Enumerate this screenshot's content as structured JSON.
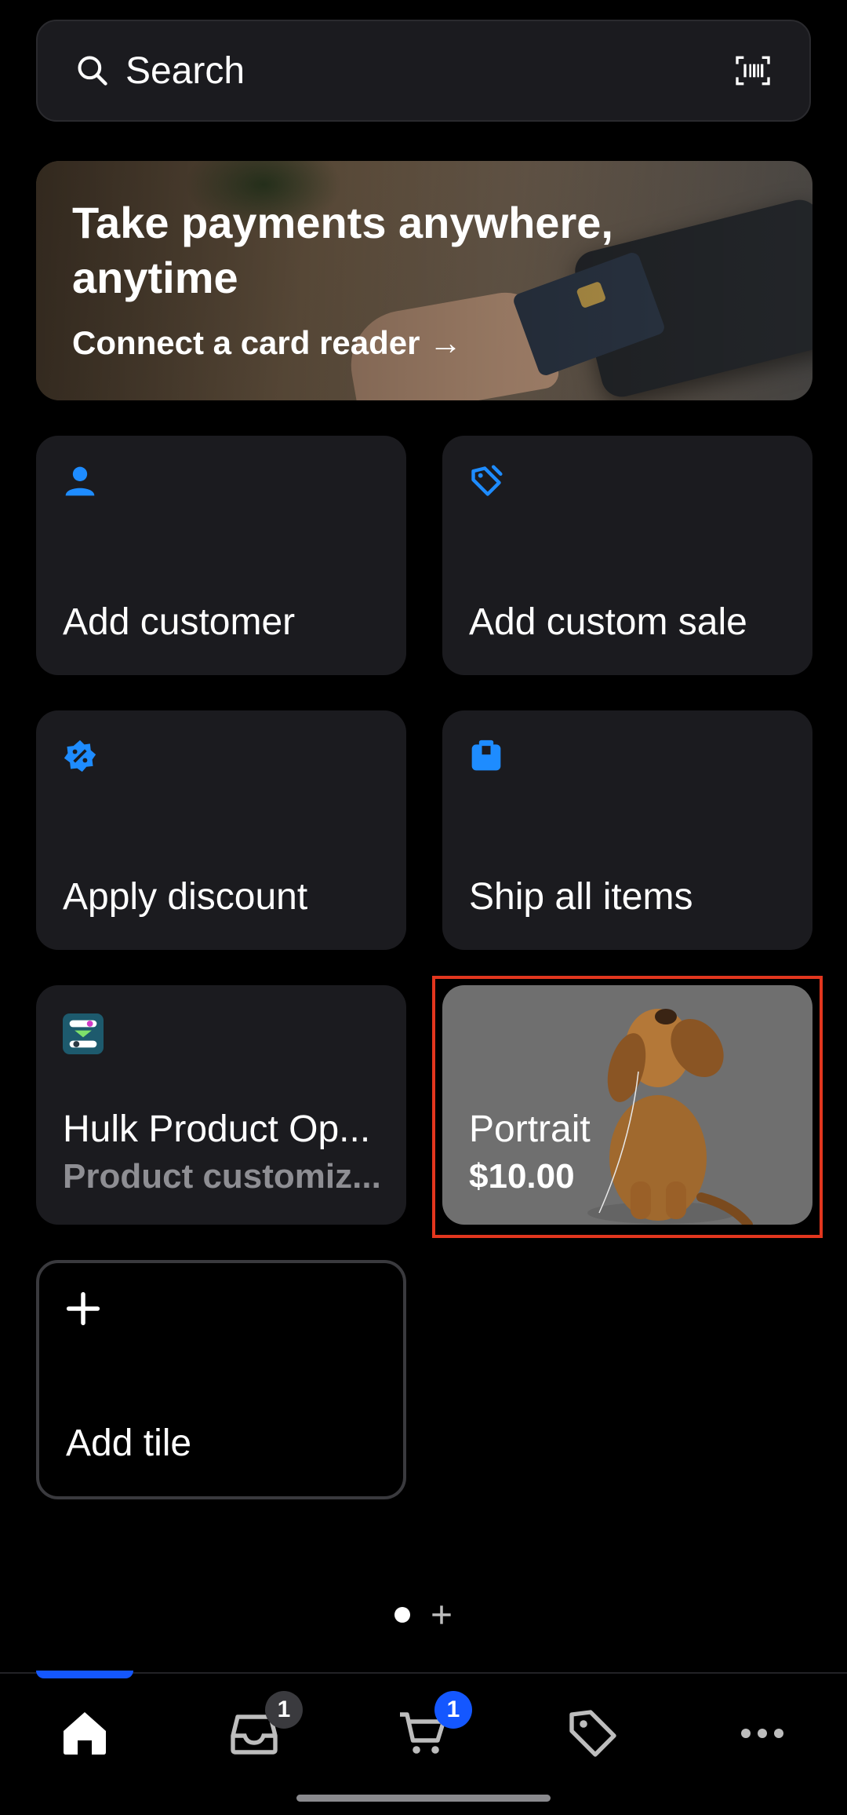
{
  "search": {
    "placeholder": "Search"
  },
  "banner": {
    "title": "Take payments anywhere, anytime",
    "link": "Connect a card reader →"
  },
  "tiles": [
    {
      "label": "Add customer",
      "icon": "person-icon"
    },
    {
      "label": "Add custom sale",
      "icon": "tag-edit-icon"
    },
    {
      "label": "Apply discount",
      "icon": "discount-badge-icon"
    },
    {
      "label": "Ship all items",
      "icon": "package-icon"
    },
    {
      "label": "Hulk Product Op...",
      "sublabel": "Product customiz...",
      "icon": "app-logo-icon"
    },
    {
      "label": "Portrait",
      "price": "$10.00"
    },
    {
      "label": "Add tile",
      "icon": "plus-icon"
    }
  ],
  "nav": {
    "items": [
      {
        "name": "Home",
        "icon": "home-icon"
      },
      {
        "name": "Orders",
        "icon": "inbox-icon",
        "badge": "1"
      },
      {
        "name": "Cart",
        "icon": "cart-icon",
        "badge": "1"
      },
      {
        "name": "Products",
        "icon": "tag-icon"
      },
      {
        "name": "More",
        "icon": "more-icon"
      }
    ]
  },
  "colors": {
    "accent": "#1457ff",
    "icon_blue": "#1e8cff",
    "highlight": "#e2361e",
    "tile_bg": "#1b1b1f"
  }
}
